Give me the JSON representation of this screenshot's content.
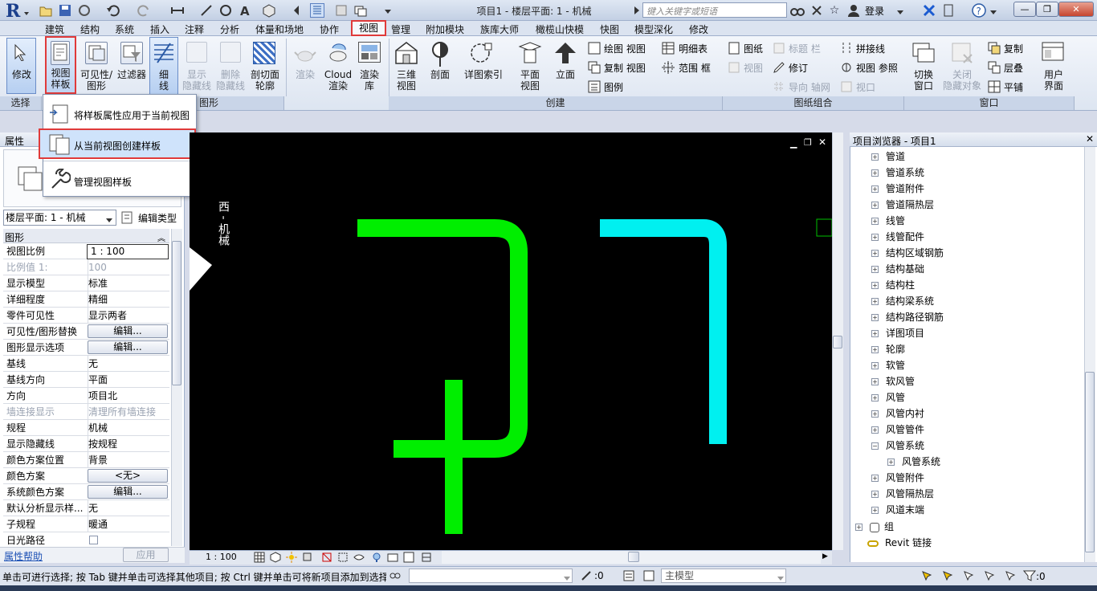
{
  "title_bar": {
    "doc_title": "项目1 - 楼层平面: 1 - 机械",
    "search_placeholder": "键入关键字或短语",
    "login_label": "登录"
  },
  "tabs": [
    "建筑",
    "结构",
    "系统",
    "插入",
    "注释",
    "分析",
    "体量和场地",
    "协作",
    "视图",
    "管理",
    "附加模块",
    "族库大师",
    "橄榄山快模",
    "快图",
    "模型深化",
    "修改"
  ],
  "ribbon": {
    "modify_label": "修改",
    "select_label": "选择",
    "view_template_label_1": "视图",
    "view_template_label_2": "样板",
    "visibility_label_1": "可见性/",
    "visibility_label_2": "图形",
    "filters_label": "过滤器",
    "thin_lines_label_1": "细",
    "thin_lines_label_2": "线",
    "show_hidden_1": "显示",
    "show_hidden_2": "隐藏线",
    "remove_hidden_1": "删除",
    "remove_hidden_2": "隐藏线",
    "cut_profile_1": "剖切面",
    "cut_profile_2": "轮廓",
    "graphics_panel": "图形",
    "render_label": "渲染",
    "cloud_render_1": "Cloud",
    "cloud_render_2": "渲染",
    "render_gallery_1": "渲染",
    "render_gallery_2": "库",
    "view3d_1": "三维",
    "view3d_2": "视图",
    "section_label": "剖面",
    "callout_label": "详图索引",
    "plan_view_1": "平面",
    "plan_view_2": "视图",
    "elevation_label": "立面",
    "drafting_view": "绘图 视图",
    "duplicate_view": "复制 视图",
    "legends": "图例",
    "schedules": "明细表",
    "scope_box": "范围 框",
    "create_panel": "创建",
    "sheet": "图纸",
    "title_block": "标题 栏",
    "view_btn": "视图",
    "revision": "修订",
    "guide_grid": "导向 轴网",
    "matchline": "拼接线",
    "view_reference": "视图 参照",
    "viewports": "视口",
    "sheet_panel": "图纸组合",
    "switch_windows_1": "切换",
    "switch_windows_2": "窗口",
    "close_hidden_1": "关闭",
    "close_hidden_2": "隐藏对象",
    "replicate": "复制",
    "cascade": "层叠",
    "tile": "平铺",
    "user_interface_1": "用户",
    "user_interface_2": "界面",
    "window_panel": "窗口"
  },
  "dropdown": {
    "items": [
      "将样板属性应用于当前视图",
      "从当前视图创建样板",
      "管理视图样板"
    ]
  },
  "properties": {
    "header": "属性",
    "type_selector": "楼层平面: 1 - 机械",
    "edit_type": "编辑类型",
    "group_graphics": "图形",
    "rows": [
      {
        "key": "视图比例",
        "value": "1 : 100"
      },
      {
        "key": "比例值 1:",
        "value": "100"
      },
      {
        "key": "显示模型",
        "value": "标准"
      },
      {
        "key": "详细程度",
        "value": "精细"
      },
      {
        "key": "零件可见性",
        "value": "显示两者"
      },
      {
        "key": "可见性/图形替换",
        "value": "编辑..."
      },
      {
        "key": "图形显示选项",
        "value": "编辑..."
      },
      {
        "key": "基线",
        "value": "无"
      },
      {
        "key": "基线方向",
        "value": "平面"
      },
      {
        "key": "方向",
        "value": "项目北"
      },
      {
        "key": "墙连接显示",
        "value": "清理所有墙连接"
      },
      {
        "key": "规程",
        "value": "机械"
      },
      {
        "key": "显示隐藏线",
        "value": "按规程"
      },
      {
        "key": "颜色方案位置",
        "value": "背景"
      },
      {
        "key": "颜色方案",
        "value": "<无>"
      },
      {
        "key": "系统颜色方案",
        "value": "编辑..."
      },
      {
        "key": "默认分析显示样...",
        "value": "无"
      },
      {
        "key": "子规程",
        "value": "暖通"
      },
      {
        "key": "日光路径",
        "value": ""
      }
    ],
    "help_link": "属性帮助",
    "apply_button": "应用"
  },
  "canvas": {
    "elevation_label": "西 - 机械",
    "scale_label": "1 : 100",
    "pipe_green": "#00ee00",
    "pipe_cyan": "#00f0f0",
    "background": "#000000"
  },
  "project_browser": {
    "header": "项目浏览器 - 项目1",
    "items": [
      "管道",
      "管道系统",
      "管道附件",
      "管道隔热层",
      "线管",
      "线管配件",
      "结构区域钢筋",
      "结构基础",
      "结构柱",
      "结构梁系统",
      "结构路径钢筋",
      "详图项目",
      "轮廓",
      "软管",
      "软风管",
      "风管",
      "风管内衬",
      "风管管件",
      "风管系统",
      "风管系统",
      "风管附件",
      "风管隔热层",
      "风道末端"
    ],
    "group": "组",
    "revit_links": "Revit 链接"
  },
  "status_bar": {
    "message": "单击可进行选择; 按 Tab 键并单击可选择其他项目; 按 Ctrl 键并单击可将新项目添加到选择",
    "count": ":0",
    "model": "主模型",
    "filter_count": ":0"
  },
  "colors": {
    "highlight_red": "#e03a3a",
    "ribbon_bg": "#e9eef6"
  }
}
